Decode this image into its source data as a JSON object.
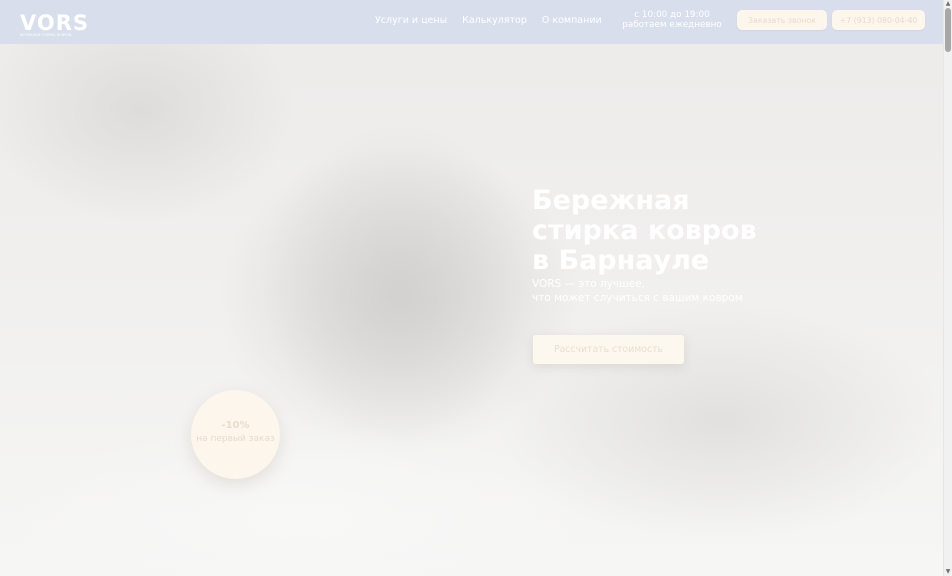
{
  "header": {
    "logo": {
      "text": "VORS",
      "tagline": "БЕРЕЖНАЯ СТИРКА КОВРОВ"
    },
    "nav": [
      {
        "label": "Услуги и цены"
      },
      {
        "label": "Калькулятор"
      },
      {
        "label": "О компании"
      }
    ],
    "hours": {
      "line1": "с 10:00 до 19:00",
      "line2": "работаем ежедневно"
    },
    "call_button": "Заказать звонок",
    "phone_button": "+7 (913) 080-04-40"
  },
  "hero": {
    "title_lines": [
      "Бережная",
      "стирка ковров",
      "в Барнауле"
    ],
    "subtitle_lines": [
      "VORS — это лучшее,",
      "что может случиться с вашим ковром"
    ],
    "cta_label": "Рассчитать стоимость"
  },
  "promo": {
    "discount": "-10%",
    "text": "на первый заказ"
  },
  "colors": {
    "header_bg": "#d8deeb",
    "button_bg": "#fcf6ec",
    "button_text": "#e6dccd",
    "hero_text": "#ffffff"
  },
  "icons": {
    "scroll_up": "scroll-up-arrow-icon",
    "scroll_down": "scroll-down-arrow-icon"
  }
}
